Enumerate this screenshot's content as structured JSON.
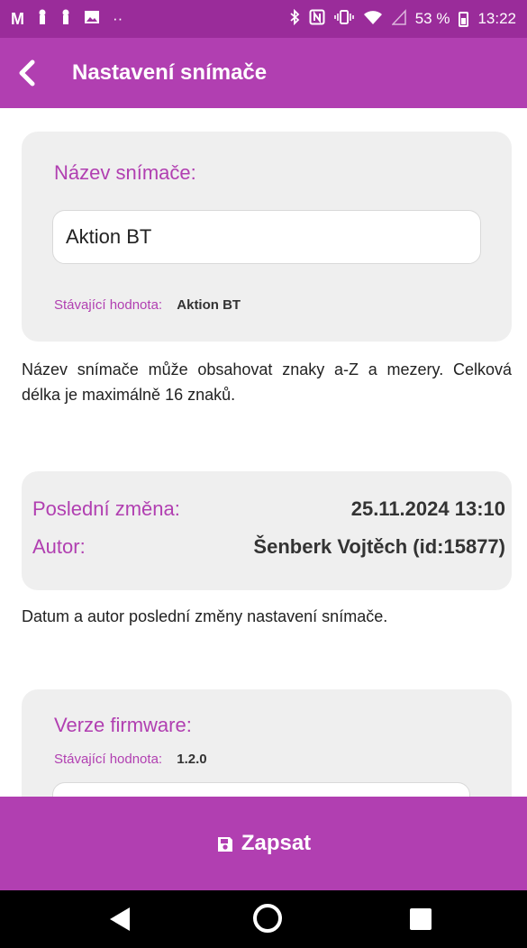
{
  "status_bar": {
    "left_icons": [
      "gmail-icon",
      "notification-icon",
      "notification-icon",
      "image-icon"
    ],
    "overflow_dots": "··",
    "battery": "53 %",
    "time": "13:22",
    "right_icons": [
      "bluetooth-icon",
      "nfc-icon",
      "vibrate-icon",
      "wifi-icon",
      "no-signal-icon",
      "battery-icon"
    ]
  },
  "header": {
    "title": "Nastavení snímače",
    "back_icon": "chevron-left-icon"
  },
  "sensor_name": {
    "label": "Název snímače:",
    "value": "Aktion BT",
    "current_label": "Stávající hodnota:",
    "current_value": "Aktion BT",
    "help": "Název snímače může obsahovat znaky a-Z a mezery. Celková délka je maximálně 16 znaků."
  },
  "last_change": {
    "changed_label": "Poslední změna:",
    "changed_value": "25.11.2024 13:10",
    "author_label": "Autor:",
    "author_value": "Šenberk Vojtěch (id:15877)",
    "help": "Datum a autor poslední změny nastavení snímače."
  },
  "firmware": {
    "label": "Verze firmware:",
    "current_label": "Stávající hodnota:",
    "current_value": "1.2.0"
  },
  "actions": {
    "write_label": "Zapsat",
    "write_icon": "save-icon"
  },
  "colors": {
    "accent": "#b13fb1",
    "status_bar": "#9a2c9a",
    "card": "#efefef",
    "nav_bar": "#000000"
  },
  "nav_bar": {
    "icons": [
      "back-triangle-icon",
      "home-circle-icon",
      "recents-square-icon"
    ]
  }
}
